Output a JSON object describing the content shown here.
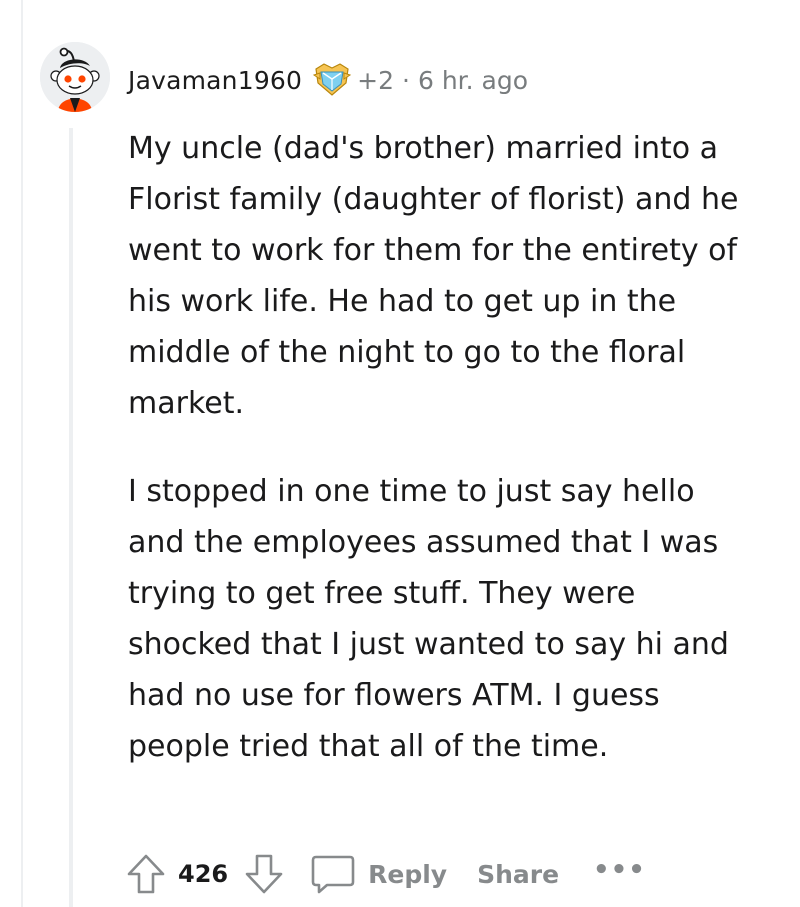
{
  "comment": {
    "author": "Javaman1960",
    "award_icon": "crystal-award-icon",
    "karma": "+2",
    "separator": "·",
    "timestamp": "6 hr. ago",
    "paragraphs": [
      "My uncle (dad's brother) married into a Florist family (daughter of florist) and he went to work for them for the entirety of his work life. He had to get up in the middle of the night to go to the floral market.",
      "I stopped in one time to just say hello and the employees assumed that I was trying to get free stuff. They were shocked that I just wanted to say hi and had no use for flowers ATM. I guess people tried that all of the time."
    ]
  },
  "actions": {
    "score": "426",
    "reply_label": "Reply",
    "share_label": "Share",
    "more_label": "•••"
  },
  "colors": {
    "text": "#1a1a1b",
    "meta": "#787c7e",
    "action": "#878a8c",
    "thread_line": "#edeff1",
    "avatar_accent": "#ff4500"
  }
}
